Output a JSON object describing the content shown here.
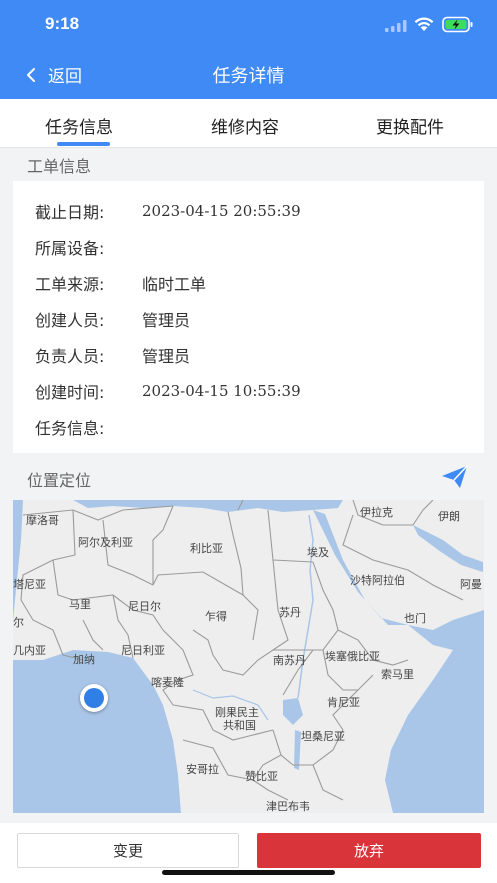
{
  "status_bar": {
    "time": "9:18"
  },
  "nav": {
    "back_label": "返回",
    "title": "任务详情"
  },
  "tabs": [
    {
      "label": "任务信息",
      "active": true
    },
    {
      "label": "维修内容",
      "active": false
    },
    {
      "label": "更换配件",
      "active": false
    }
  ],
  "work_order": {
    "section_title": "工单信息",
    "fields": [
      {
        "label": "截止日期:",
        "value": "2023-04-15 20:55:39"
      },
      {
        "label": "所属设备:",
        "value": ""
      },
      {
        "label": "工单来源:",
        "value": "临时工单"
      },
      {
        "label": "创建人员:",
        "value": "管理员"
      },
      {
        "label": "负责人员:",
        "value": "管理员"
      },
      {
        "label": "创建时间:",
        "value": "2023-04-15 10:55:39"
      },
      {
        "label": "任务信息:",
        "value": ""
      }
    ]
  },
  "location": {
    "section_title": "位置定位",
    "map_labels": [
      "摩洛哥",
      "阿尔及利亚",
      "利比亚",
      "埃及",
      "伊拉克",
      "伊朗",
      "塔尼亚",
      "马里",
      "尼日尔",
      "乍得",
      "苏丹",
      "沙特阿拉伯",
      "阿曼",
      "尔",
      "尼日利亚",
      "也门",
      "几内亚",
      "加纳",
      "南苏丹",
      "埃塞俄比亚",
      "索马里",
      "喀麦隆",
      "刚果民主",
      "共和国",
      "肯尼亚",
      "坦桑尼亚",
      "安哥拉",
      "赞比亚",
      "津巴布韦"
    ]
  },
  "actions": {
    "change_label": "变更",
    "abandon_label": "放弃"
  },
  "colors": {
    "primary": "#3f8af5",
    "danger": "#d9343a",
    "water": "#a9c6e8",
    "land": "#eeeeee",
    "border": "#9b9b9b"
  }
}
